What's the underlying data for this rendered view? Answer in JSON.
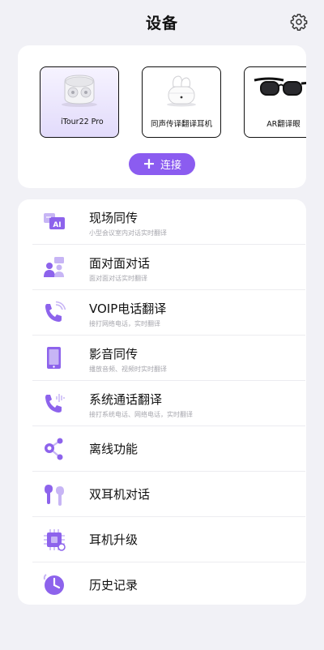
{
  "header": {
    "title": "设备",
    "settings_icon": "gear-icon"
  },
  "devices": [
    {
      "label": "iTour22  Pro",
      "selected": true,
      "icon": "earbuds-case-icon"
    },
    {
      "label": "同声传译翻译耳机",
      "selected": false,
      "icon": "earbuds-white-icon"
    },
    {
      "label": "AR翻译眼",
      "selected": false,
      "icon": "ar-glasses-icon"
    }
  ],
  "connect": {
    "label": "连接"
  },
  "menu": [
    {
      "title": "现场同传",
      "subtitle": "小型会议室内对话实时翻译",
      "icon": "ai-translate-icon"
    },
    {
      "title": "面对面对话",
      "subtitle": "面对面对话实时翻译",
      "icon": "face-to-face-icon"
    },
    {
      "title": "VOIP电话翻译",
      "subtitle": "接打网络电话，实时翻译",
      "icon": "voip-phone-icon"
    },
    {
      "title": "影音同传",
      "subtitle": "播放音频、视频时实时翻译",
      "icon": "media-tablet-icon"
    },
    {
      "title": "系统通话翻译",
      "subtitle": "接打系统电话、网络电话，实时翻译",
      "icon": "system-call-icon"
    },
    {
      "title": "离线功能",
      "subtitle": "",
      "icon": "offline-nodes-icon"
    },
    {
      "title": "双耳机对话",
      "subtitle": "",
      "icon": "dual-earbuds-icon"
    },
    {
      "title": "耳机升级",
      "subtitle": "",
      "icon": "chip-upgrade-icon"
    },
    {
      "title": "历史记录",
      "subtitle": "",
      "icon": "history-clock-icon"
    }
  ],
  "colors": {
    "accent": "#8b5cf0",
    "icon_light": "#c7b5f5",
    "icon_dark": "#8d63ec",
    "background": "#f1f1f6"
  }
}
